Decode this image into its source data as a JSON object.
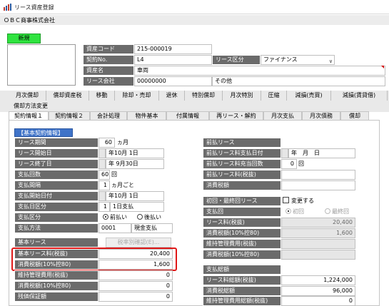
{
  "window": {
    "title": "リース資産登録"
  },
  "company": "ＯＢＣ商事株式会社",
  "new_button": "新規",
  "header": {
    "asset_code_label": "資産コード",
    "asset_code": "215-000019",
    "contract_no_label": "契約No.",
    "contract_no": "L4",
    "lease_type_label": "リース区分",
    "lease_type": "ファイナンス",
    "asset_name_label": "資産名",
    "asset_name": "車両",
    "lease_company_label": "リース会社",
    "lease_company_code": "00000000",
    "lease_company_name": "その他"
  },
  "menu": [
    "月次償却",
    "償却資産税",
    "移動",
    "除却・売却",
    "退休",
    "特別償却",
    "月次特別",
    "圧縮",
    "減損(売買)",
    "減損(賃貸借)",
    "償却方法変更"
  ],
  "tabs": [
    "契約情報１",
    "契約情報２",
    "会計処理",
    "物件基本",
    "付属情報",
    "再リース・解約",
    "月次支払",
    "月次債務",
    "償却"
  ],
  "basic": {
    "section": "【基本契約情報】",
    "rows": [
      {
        "label": "リース期間",
        "value": "60",
        "unit": "ヵ月"
      },
      {
        "label": "リース開始日",
        "value": "年10月 1日"
      },
      {
        "label": "リース終了日",
        "value": "年 9月30日"
      },
      {
        "label": "支払回数",
        "value": "60",
        "unit": "回"
      },
      {
        "label": "支払間隔",
        "value": "1",
        "unit": "ヵ月ごと"
      },
      {
        "label": "支払開始日付",
        "value": "年10月 1日"
      },
      {
        "label": "支払日区分",
        "value": "1",
        "unit": "1日支払"
      },
      {
        "label": "支払区分",
        "opt1": "前払い",
        "opt2": "後払い"
      },
      {
        "label": "支払方法",
        "value": "0001",
        "unit": "現金支払"
      }
    ]
  },
  "base_lease": {
    "section": "基本リース",
    "tax_button": "税率別確認(E)...",
    "rows": [
      {
        "label": "基本リース料(税抜)",
        "value": "20,400"
      },
      {
        "label": "消費税額(10%控80)",
        "value": "1,600"
      },
      {
        "label": "維持管理費用(税抜)",
        "value": "0"
      },
      {
        "label": "消費税額(10%控80)",
        "value": "0"
      },
      {
        "label": "残価保証額",
        "value": "0"
      }
    ]
  },
  "prepaid": {
    "section": "前払リース",
    "rows": [
      {
        "label": "前払リース料支払日付",
        "value": "年　月　日"
      },
      {
        "label": "前払リース料充当回数",
        "value": "0",
        "unit": "回"
      },
      {
        "label": "前払リース料(税抜)",
        "value": ""
      },
      {
        "label": "消費税額",
        "value": ""
      }
    ]
  },
  "first_last": {
    "section": "初回・最終回リース",
    "change_label": "変更する",
    "rows": [
      {
        "label": "支払回",
        "opt1": "初回",
        "opt2": "最終回"
      },
      {
        "label": "リース料(税抜)",
        "value": "20,400"
      },
      {
        "label": "消費税額(10%控80)",
        "value": "1,600"
      },
      {
        "label": "維持管理費用(税抜)",
        "value": ""
      },
      {
        "label": "消費税額(10%控80)",
        "value": ""
      }
    ]
  },
  "total": {
    "section": "支払総額",
    "rows": [
      {
        "label": "リース料総額(税抜)",
        "value": "1,224,000"
      },
      {
        "label": "消費税総額",
        "value": "96,000"
      },
      {
        "label": "維持管理費用総額(税抜)",
        "value": "0"
      }
    ]
  }
}
